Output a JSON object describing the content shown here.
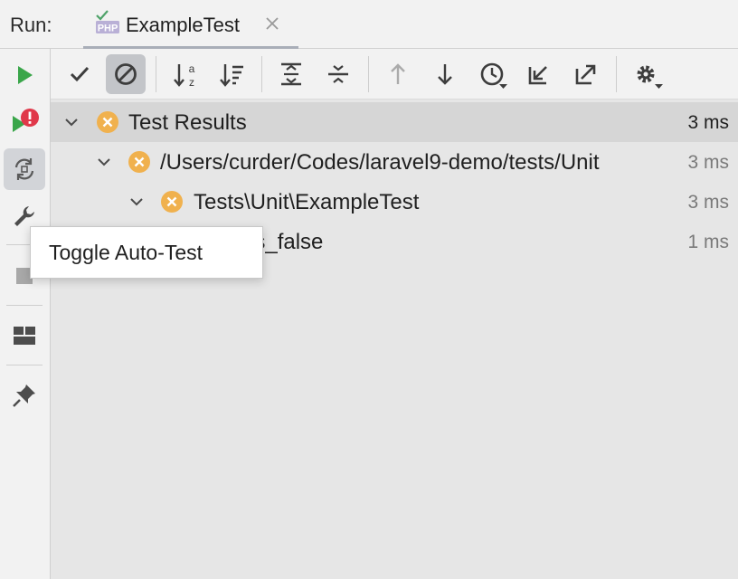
{
  "titlebar": {
    "run_label": "Run:",
    "tab": {
      "badge": "PHP",
      "label": "ExampleTest",
      "icon": "php-test-icon"
    }
  },
  "left_toolbar": {
    "items": [
      {
        "name": "rerun-icon",
        "tooltip": ""
      },
      {
        "name": "rerun-failed-icon",
        "tooltip": ""
      },
      {
        "name": "toggle-auto-test-icon",
        "tooltip": "Toggle Auto-Test"
      },
      {
        "name": "wrench-icon",
        "tooltip": ""
      },
      {
        "name": "stop-icon",
        "tooltip": ""
      },
      {
        "name": "layout-icon",
        "tooltip": ""
      },
      {
        "name": "pin-icon",
        "tooltip": ""
      }
    ],
    "colors": {
      "run": "#3aa64a",
      "error": "#e0384a"
    }
  },
  "top_toolbar": {
    "items": [
      "show-passed-icon",
      "show-ignored-icon",
      "sort-alphabetically-icon",
      "sort-by-duration-icon",
      "expand-all-icon",
      "collapse-all-icon",
      "previous-failed-icon",
      "next-failed-icon",
      "history-icon",
      "import-tests-icon",
      "export-results-icon",
      "settings-icon"
    ]
  },
  "tree": {
    "rows": [
      {
        "label": "Test Results",
        "time": "3 ms",
        "status": "ignored"
      },
      {
        "label": "/Users/curder/Codes/laravel9-demo/tests/Unit",
        "time": "3 ms",
        "status": "ignored"
      },
      {
        "label": "Tests\\Unit\\ExampleTest",
        "time": "3 ms",
        "status": "ignored"
      },
      {
        "label": "t_is_false",
        "time": "1 ms",
        "status": "ignored"
      }
    ],
    "status_color": "#f0b14e"
  },
  "tooltip": {
    "text": "Toggle Auto-Test"
  }
}
